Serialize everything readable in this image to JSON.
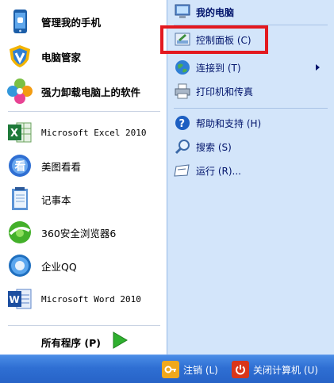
{
  "left_pane": {
    "pinned": [
      {
        "label": "管理我的手机",
        "icon": "phone-manager-icon"
      },
      {
        "label": "电脑管家",
        "icon": "shield-icon"
      },
      {
        "label": "强力卸载电脑上的软件",
        "icon": "uninstall-icon"
      }
    ],
    "recent": [
      {
        "label": "Microsoft Excel 2010",
        "icon": "excel-icon"
      },
      {
        "label": "美图看看",
        "icon": "meitu-icon"
      },
      {
        "label": "记事本",
        "icon": "notepad-icon"
      },
      {
        "label": "360安全浏览器6",
        "icon": "browser-360-icon"
      },
      {
        "label": "企业QQ",
        "icon": "qq-icon"
      },
      {
        "label": "Microsoft Word 2010",
        "icon": "word-icon"
      }
    ],
    "all_programs_label": "所有程序 (P)"
  },
  "right_pane": {
    "items": [
      {
        "label": "我的电脑",
        "icon": "my-computer-icon"
      },
      {
        "label": "控制面板 (C)",
        "icon": "control-panel-icon"
      },
      {
        "label": "连接到 (T)",
        "icon": "connect-to-icon"
      },
      {
        "label": "打印机和传真",
        "icon": "printer-icon"
      },
      {
        "label": "帮助和支持 (H)",
        "icon": "help-icon"
      },
      {
        "label": "搜索 (S)",
        "icon": "search-icon"
      },
      {
        "label": "运行 (R)...",
        "icon": "run-icon"
      }
    ]
  },
  "bottom_bar": {
    "logoff_label": "注销 (L)",
    "shutdown_label": "关闭计算机 (U)"
  },
  "colors": {
    "right_pane_bg": "#d3e5fa",
    "right_text": "#00136b",
    "bottom_bar": "#2f6fd3",
    "highlight": "#e3191f",
    "arrow_green": "#2fb02f"
  }
}
